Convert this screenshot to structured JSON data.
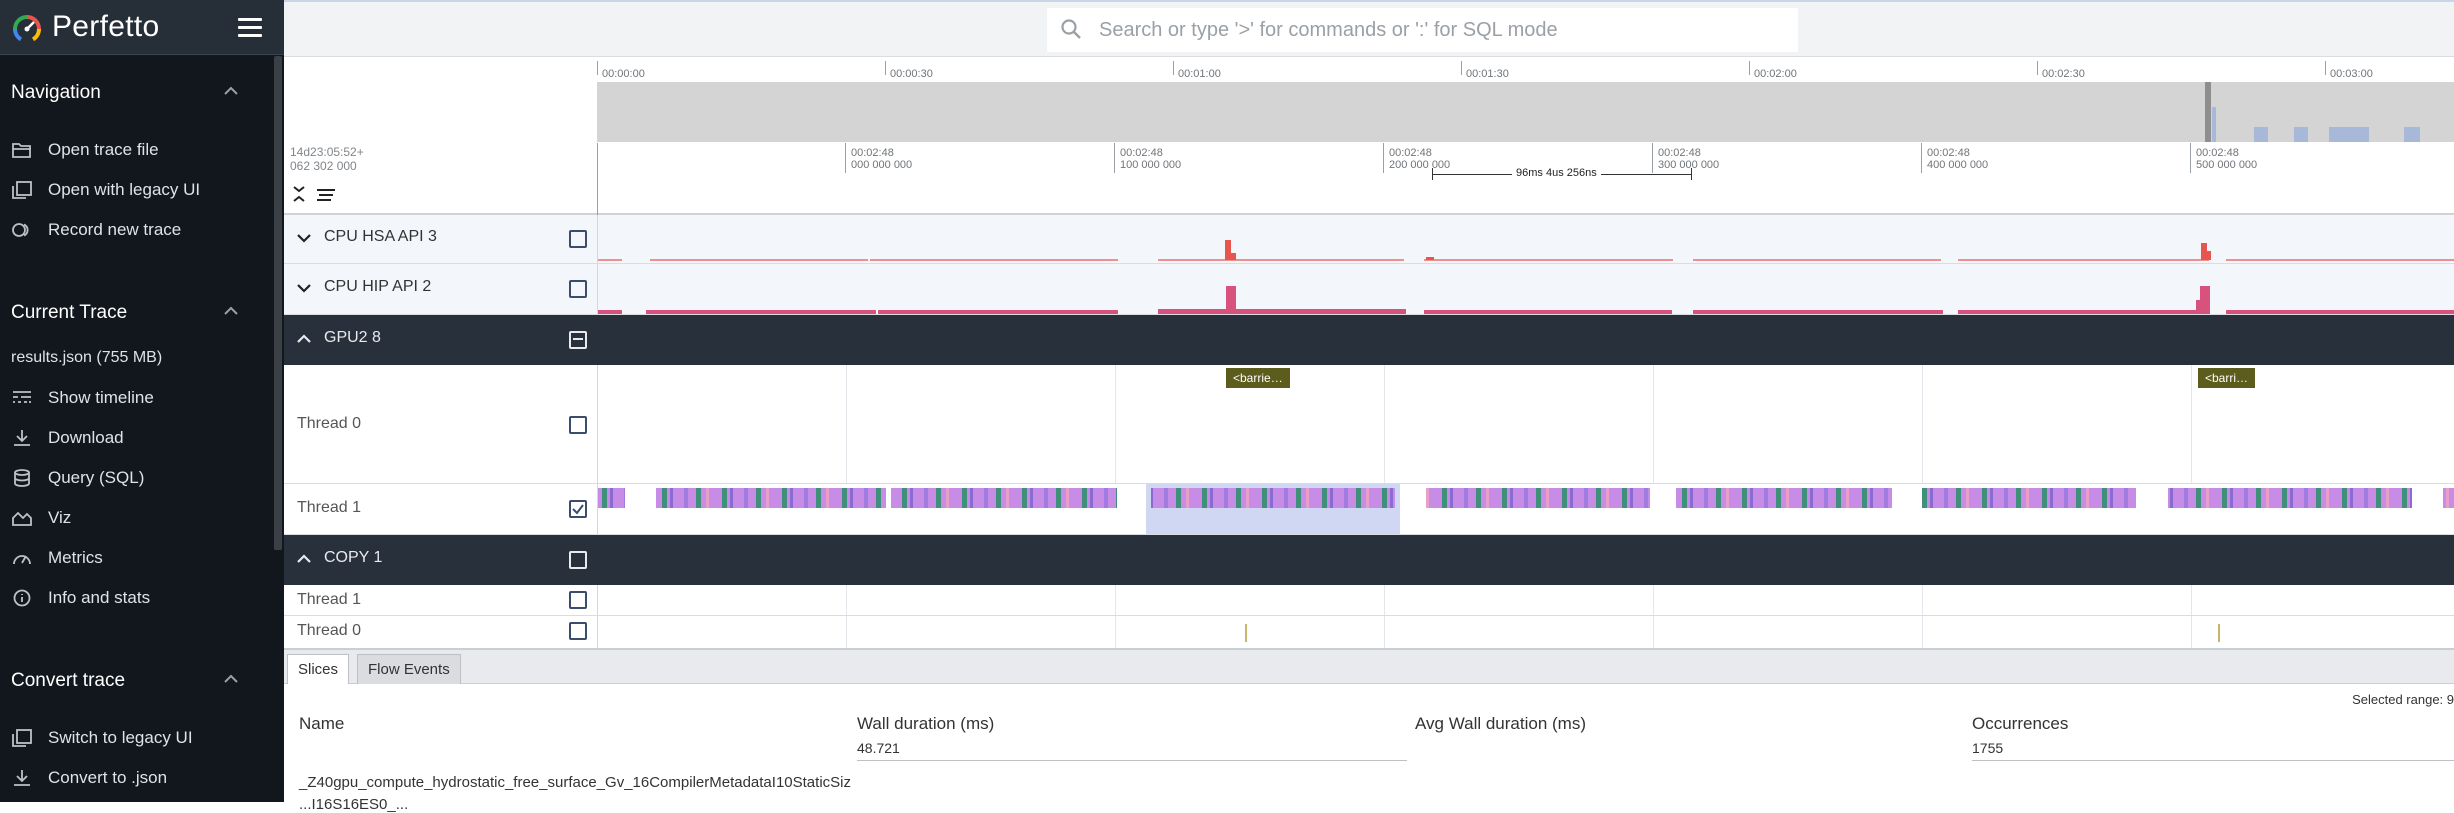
{
  "app": {
    "title": "Perfetto",
    "accent_red": "#e8554f",
    "accent_dark": "#28303c"
  },
  "sidebar": {
    "sections": [
      {
        "title": "Navigation",
        "items": [
          {
            "label": "Open trace file",
            "icon": "folder-open-icon"
          },
          {
            "label": "Open with legacy UI",
            "icon": "filter-none-icon"
          },
          {
            "label": "Record new trace",
            "icon": "fiber-smart-record-icon"
          }
        ]
      },
      {
        "title": "Current Trace",
        "file": "results.json (755 MB)",
        "items": [
          {
            "label": "Show timeline",
            "icon": "line-style-icon"
          },
          {
            "label": "Download",
            "icon": "download-icon"
          },
          {
            "label": "Query (SQL)",
            "icon": "database-icon"
          },
          {
            "label": "Viz",
            "icon": "area-chart-icon"
          },
          {
            "label": "Metrics",
            "icon": "speed-icon"
          },
          {
            "label": "Info and stats",
            "icon": "info-icon"
          }
        ]
      },
      {
        "title": "Convert trace",
        "items": [
          {
            "label": "Switch to legacy UI",
            "icon": "filter-none-icon"
          },
          {
            "label": "Convert to .json",
            "icon": "download-icon"
          }
        ]
      }
    ]
  },
  "search": {
    "placeholder": "Search or type '>' for commands or ':' for SQL mode",
    "value": ""
  },
  "overview_axis": [
    "00:00:00",
    "00:00:30",
    "00:01:00",
    "00:01:30",
    "00:02:00",
    "00:02:30",
    "00:03:00"
  ],
  "timeline": {
    "offset_line1": "14d23:05:52+",
    "offset_line2": "062 302 000",
    "ticks": [
      {
        "line1": "00:02:48",
        "line2": "000 000 000"
      },
      {
        "line1": "00:02:48",
        "line2": "100 000 000"
      },
      {
        "line1": "00:02:48",
        "line2": "200 000 000"
      },
      {
        "line1": "00:02:48",
        "line2": "300 000 000"
      },
      {
        "line1": "00:02:48",
        "line2": "400 000 000"
      },
      {
        "line1": "00:02:48",
        "line2": "500 000 000"
      }
    ],
    "measurement": "96ms 4us 256ns"
  },
  "tracks": [
    {
      "name": "CPU HSA API 3",
      "kind": "group-light",
      "checked": false
    },
    {
      "name": "CPU HIP API 2",
      "kind": "group-light",
      "checked": false
    },
    {
      "name": "GPU2 8",
      "kind": "group-dark",
      "checked": "partial"
    },
    {
      "name": "Thread 0",
      "kind": "thread",
      "checked": false,
      "slices": [
        "<barrie…",
        "<barri…"
      ]
    },
    {
      "name": "Thread 1",
      "kind": "thread",
      "checked": true
    },
    {
      "name": "COPY 1",
      "kind": "group-dark",
      "checked": false
    },
    {
      "name": "Thread 1",
      "kind": "thread",
      "checked": false
    },
    {
      "name": "Thread 0",
      "kind": "thread",
      "checked": false
    }
  ],
  "details": {
    "tabs": [
      "Slices",
      "Flow Events"
    ],
    "active_tab": "Slices",
    "selected_range": "Selected range: 9",
    "columns": [
      {
        "header": "Name",
        "value": ""
      },
      {
        "header": "Wall duration (ms)",
        "value": "48.721"
      },
      {
        "header": "Avg Wall duration (ms)",
        "value": ""
      },
      {
        "header": "Occurrences",
        "value": "1755"
      }
    ],
    "rows": [
      {
        "name": "_Z40gpu_compute_hydrostatic_free_surface_Gv_16CompilerMetadataI10StaticSiz"
      },
      {
        "name": "...I16S16ES0_..."
      }
    ]
  }
}
